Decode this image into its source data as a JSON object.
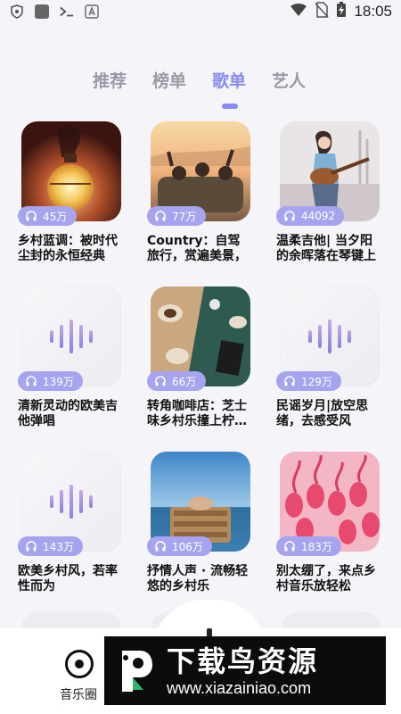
{
  "status_bar": {
    "time": "18:05",
    "icons": [
      "shield-icon",
      "app-square-icon",
      "terminal-icon",
      "font-icon",
      "wifi-icon",
      "no-sim-icon",
      "battery-charging-icon"
    ]
  },
  "tabs": [
    {
      "label": "推荐",
      "active": false
    },
    {
      "label": "榜单",
      "active": false
    },
    {
      "label": "歌单",
      "active": true
    },
    {
      "label": "艺人",
      "active": false
    }
  ],
  "colors": {
    "accent": "#8b8af0",
    "badge": "#a6a4ee",
    "inactive_tab": "#9a9aa6"
  },
  "playlists": [
    {
      "title": "乡村蓝调：被时代尘封的永恒经典",
      "plays": "45万",
      "cover": "lantern-photo"
    },
    {
      "title": "Country：自驾旅行，赏遍美景，",
      "plays": "77万",
      "cover": "road-trip-photo"
    },
    {
      "title": "温柔吉他| 当夕阳的余晖落在琴键上",
      "plays": "44092",
      "cover": "guitar-girl-illustration"
    },
    {
      "title": "清新灵动的欧美吉他弹唱",
      "plays": "139万",
      "cover": "placeholder-waveform"
    },
    {
      "title": "转角咖啡店：芝士味乡村乐撞上柠…",
      "plays": "66万",
      "cover": "cafe-table-photo"
    },
    {
      "title": "民谣岁月|放空思绪，去感受风",
      "plays": "129万",
      "cover": "placeholder-waveform"
    },
    {
      "title": "欧美乡村风，若率性而为",
      "plays": "143万",
      "cover": "placeholder-waveform"
    },
    {
      "title": "抒情人声 · 流畅轻悠的乡村乐",
      "plays": "106万",
      "cover": "beach-chair-photo"
    },
    {
      "title": "别太绷了，来点乡村音乐放轻松",
      "plays": "183万",
      "cover": "flamingo-photo"
    }
  ],
  "bottom_nav": {
    "item_label": "音乐圈"
  },
  "watermark": {
    "cn": "下载鸟资源",
    "url": "www.xiazainiao.com"
  }
}
